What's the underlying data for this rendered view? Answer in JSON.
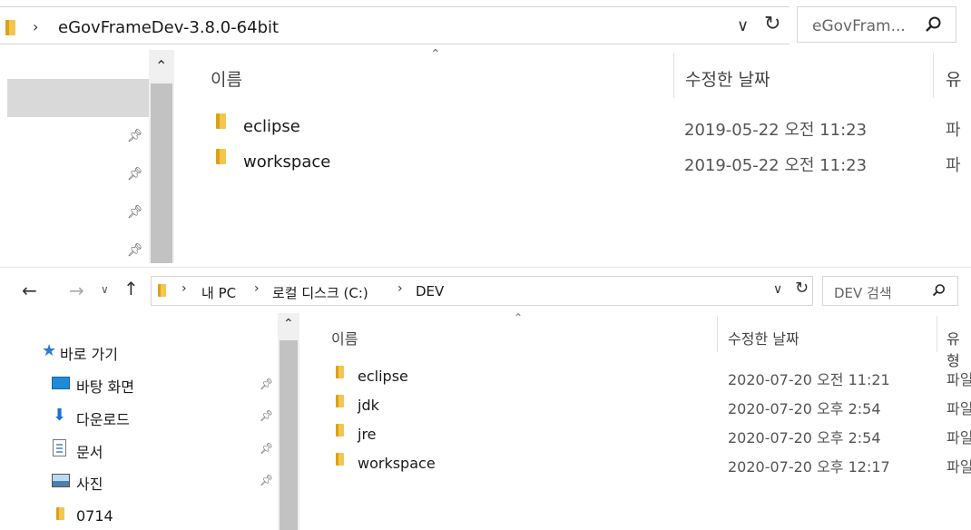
{
  "top": {
    "breadcrumb": "eGovFrameDev-3.8.0-64bit",
    "search_placeholder": "eGovFram...",
    "columns": {
      "name": "이름",
      "modified": "수정한 날짜",
      "type": "유"
    },
    "rows": [
      {
        "name": "eclipse",
        "date": "2019-05-22 오전 11:23",
        "type": "파"
      },
      {
        "name": "workspace",
        "date": "2019-05-22 오전 11:23",
        "type": "파"
      }
    ]
  },
  "bottom": {
    "breadcrumb": [
      {
        "label": "내 PC"
      },
      {
        "label": "로컬 디스크 (C:)"
      },
      {
        "label": "DEV"
      }
    ],
    "search_placeholder": "DEV 검색",
    "columns": {
      "name": "이름",
      "modified": "수정한 날짜",
      "type": "유형"
    },
    "sidebar": {
      "quick_access": "바로 가기",
      "items": [
        {
          "label": "바탕 화면",
          "icon": "desktop-icon"
        },
        {
          "label": "다운로드",
          "icon": "download-icon"
        },
        {
          "label": "문서",
          "icon": "document-icon"
        },
        {
          "label": "사진",
          "icon": "picture-icon"
        },
        {
          "label": "0714",
          "icon": "folder-icon"
        }
      ]
    },
    "rows": [
      {
        "name": "eclipse",
        "date": "2020-07-20 오전 11:21",
        "type": "파일"
      },
      {
        "name": "jdk",
        "date": "2020-07-20 오후 2:54",
        "type": "파일"
      },
      {
        "name": "jre",
        "date": "2020-07-20 오후 2:54",
        "type": "파일"
      },
      {
        "name": "workspace",
        "date": "2020-07-20 오후 12:17",
        "type": "파일"
      }
    ]
  }
}
